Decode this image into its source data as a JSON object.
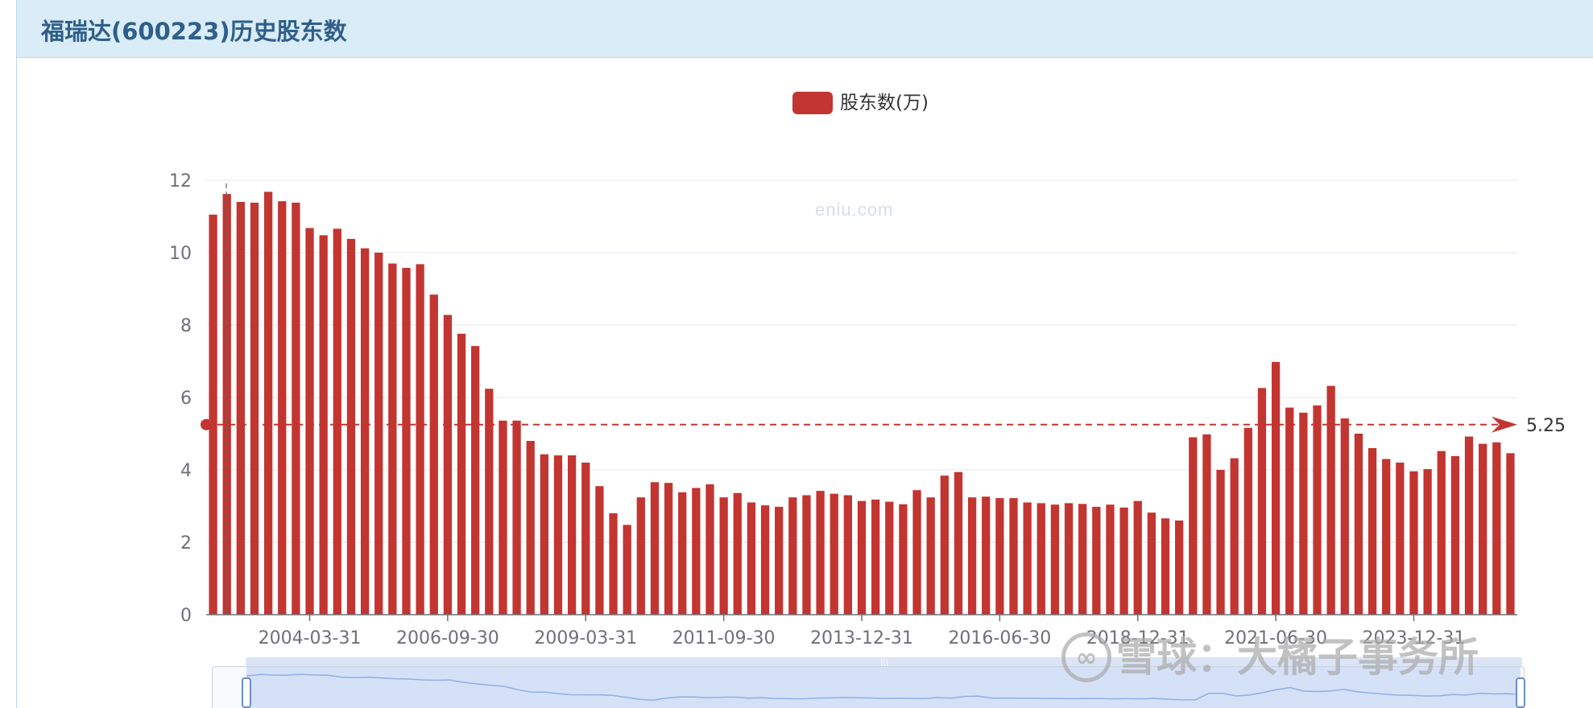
{
  "header": {
    "title": "福瑞达(600223)历史股东数"
  },
  "watermark": "eniu.com",
  "xueqiu_watermark": "雪球：大橘子事务所",
  "colors": {
    "bar": "#c23531",
    "grid": "#e3e7f3",
    "axis": "#6e7079",
    "header_bg": "#d9ecf7",
    "title": "#2f5f8a"
  },
  "chart_data": {
    "type": "bar",
    "legend": [
      "股东数(万)"
    ],
    "ylim": [
      0,
      12
    ],
    "yticks": [
      0,
      2,
      4,
      6,
      8,
      10,
      12
    ],
    "xtick_labels": [
      "2004-03-31",
      "2006-09-30",
      "2009-03-31",
      "2011-09-30",
      "2013-12-31",
      "2016-06-30",
      "2018-12-31",
      "2021-06-30",
      "2023-12-31"
    ],
    "xtick_bar_index": [
      7,
      17,
      27,
      37,
      47,
      57,
      67,
      77,
      87
    ],
    "series": [
      {
        "name": "股东数(万)",
        "values": [
          11.05,
          11.62,
          11.4,
          11.38,
          11.68,
          11.42,
          11.38,
          10.68,
          10.48,
          10.66,
          10.38,
          10.12,
          10.0,
          9.7,
          9.58,
          9.68,
          8.84,
          8.28,
          7.76,
          7.42,
          6.24,
          5.36,
          5.36,
          4.8,
          4.43,
          4.4,
          4.4,
          4.2,
          3.55,
          2.8,
          2.48,
          3.24,
          3.66,
          3.64,
          3.38,
          3.5,
          3.6,
          3.24,
          3.36,
          3.1,
          3.02,
          2.98,
          3.24,
          3.3,
          3.42,
          3.34,
          3.3,
          3.14,
          3.18,
          3.12,
          3.05,
          3.44,
          3.24,
          3.84,
          3.94,
          3.24,
          3.26,
          3.22,
          3.22,
          3.1,
          3.08,
          3.04,
          3.08,
          3.06,
          2.98,
          3.04,
          2.96,
          3.14,
          2.82,
          2.66,
          2.6,
          4.9,
          4.98,
          4.0,
          4.32,
          5.16,
          6.26,
          6.98,
          5.72,
          5.58,
          5.78,
          6.32,
          5.42,
          5.0,
          4.6,
          4.3,
          4.2,
          3.96,
          4.02,
          4.52,
          4.38,
          4.92,
          4.72,
          4.76,
          4.46
        ]
      }
    ],
    "mark_line": {
      "value": 5.25,
      "label": "5.25"
    }
  }
}
